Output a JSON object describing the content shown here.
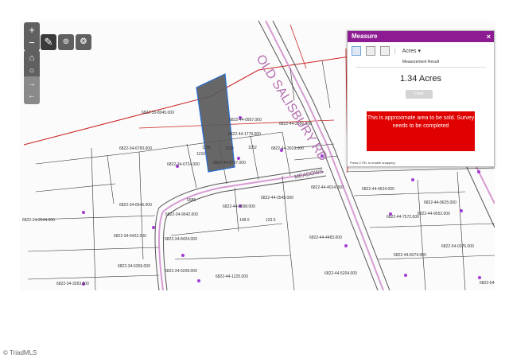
{
  "map": {
    "road_label": "OLD SALISBURY RD",
    "road_label_2": "MEADOWS",
    "parcel_labels": [
      "6822-35-8045.000",
      "6822-44-0957.000",
      "6822-44-2956.000",
      "6822-44-1779.000",
      "6822-44-3023.000",
      "6822-34-6724.000",
      "6822-44-0787.000",
      "6822-34-6783.000",
      "6822-44-4014.000",
      "6822-44-2549.000",
      "6822-34-6546.000",
      "6822-44-4624.000",
      "6822-44-0098.000",
      "6822-34-9542.000",
      "6822-44-9625.000",
      "6822-44-9052.000",
      "6822-34-2644.000",
      "6822-44-7572.000",
      "6822-34-6422.000",
      "6822-34-8424.000",
      "6822-44-4483.000",
      "6822-44-8374.000",
      "6822-54-0376.000",
      "6822-34-6359.000",
      "6822-34-6209.000",
      "6822-34-3263.000",
      "6822-44-1225.000",
      "6822-44-5204.000",
      "6822-54-1"
    ],
    "lot_numbers": [
      "1156",
      "1150",
      "1159",
      "1152",
      "6585",
      "148.0",
      "123.5"
    ]
  },
  "tools": {
    "zoom_in": "+",
    "zoom_out": "−",
    "home_icon": "home-icon",
    "locate_icon": "circle-icon",
    "forward_icon": "arrow-right-icon",
    "back_icon": "arrow-left-icon",
    "measure_icon": "pencil-icon",
    "binoculars_icon": "binoculars-icon",
    "paw_icon": "paw-icon"
  },
  "panel": {
    "title": "Measure",
    "close": "×",
    "unit": "Acres",
    "result_title": "Measurement Result",
    "result_value": "1.34 Acres",
    "clear": "Clear",
    "notice": "This is approximate area to be sold.  Survey needs to be completed",
    "hint": "Press CTRL to enable snapping",
    "header_color": "#8d1c92",
    "notice_color": "#e00000"
  },
  "copyright": "© TriadMLS"
}
